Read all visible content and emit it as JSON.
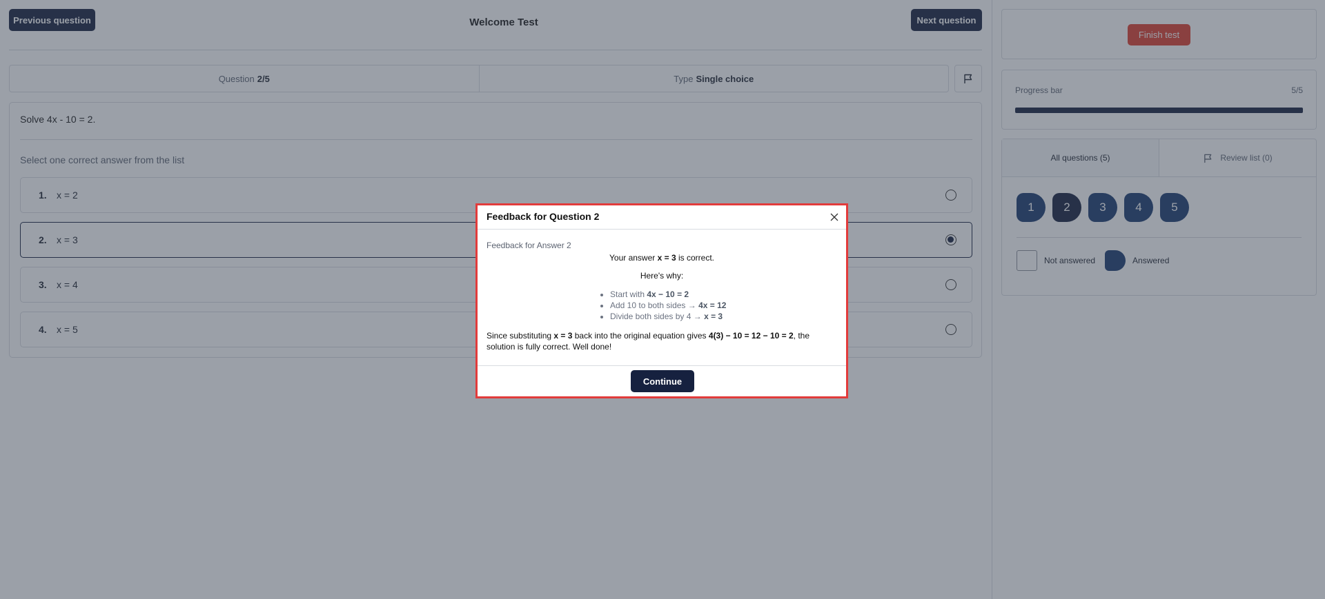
{
  "header": {
    "prev_label": "Previous question",
    "next_label": "Next question",
    "title": "Welcome Test"
  },
  "infobar": {
    "question_label": "Question",
    "question_value": "2/5",
    "type_label": "Type",
    "type_value": "Single choice",
    "flag_icon": "flag-icon"
  },
  "question": {
    "text": "Solve 4x - 10 = 2.",
    "instruction": "Select one correct answer from the list",
    "options": [
      {
        "num": "1.",
        "text": "x = 2",
        "selected": false
      },
      {
        "num": "2.",
        "text": "x = 3",
        "selected": true
      },
      {
        "num": "3.",
        "text": "x = 4",
        "selected": false
      },
      {
        "num": "4.",
        "text": "x = 5",
        "selected": false
      }
    ]
  },
  "sidebar": {
    "finish_label": "Finish test",
    "progress_label": "Progress bar",
    "progress_count": "5/5",
    "progress_fraction": 1.0,
    "tabs": {
      "all": "All questions (5)",
      "review": "Review list (0)"
    },
    "question_numbers": [
      "1",
      "2",
      "3",
      "4",
      "5"
    ],
    "current_question": "2",
    "legend": {
      "not_answered": "Not answered",
      "answered": "Answered"
    }
  },
  "modal": {
    "title": "Feedback for Question 2",
    "subtitle": "Feedback for Answer 2",
    "line1_pre": "Your answer ",
    "line1_bold": "x = 3",
    "line1_post": " is correct.",
    "why": "Here's why:",
    "steps": [
      {
        "pre": "Start with ",
        "bold": "4x − 10 = 2"
      },
      {
        "pre": "Add 10 to both sides → ",
        "bold": "4x = 12"
      },
      {
        "pre": "Divide both sides by 4 → ",
        "bold": "x = 3"
      }
    ],
    "concl_a": "Since substituting ",
    "concl_b": "x = 3",
    "concl_c": " back into the original equation gives ",
    "concl_d": "4(3) − 10 = 12 − 10 = 2",
    "concl_e": ", the solution is fully correct. Well done!",
    "continue_label": "Continue"
  },
  "colors": {
    "primary": "#16213f",
    "answered": "#1b3a6e",
    "danger": "#dc3f2e",
    "modal_border": "#e23b3b"
  }
}
